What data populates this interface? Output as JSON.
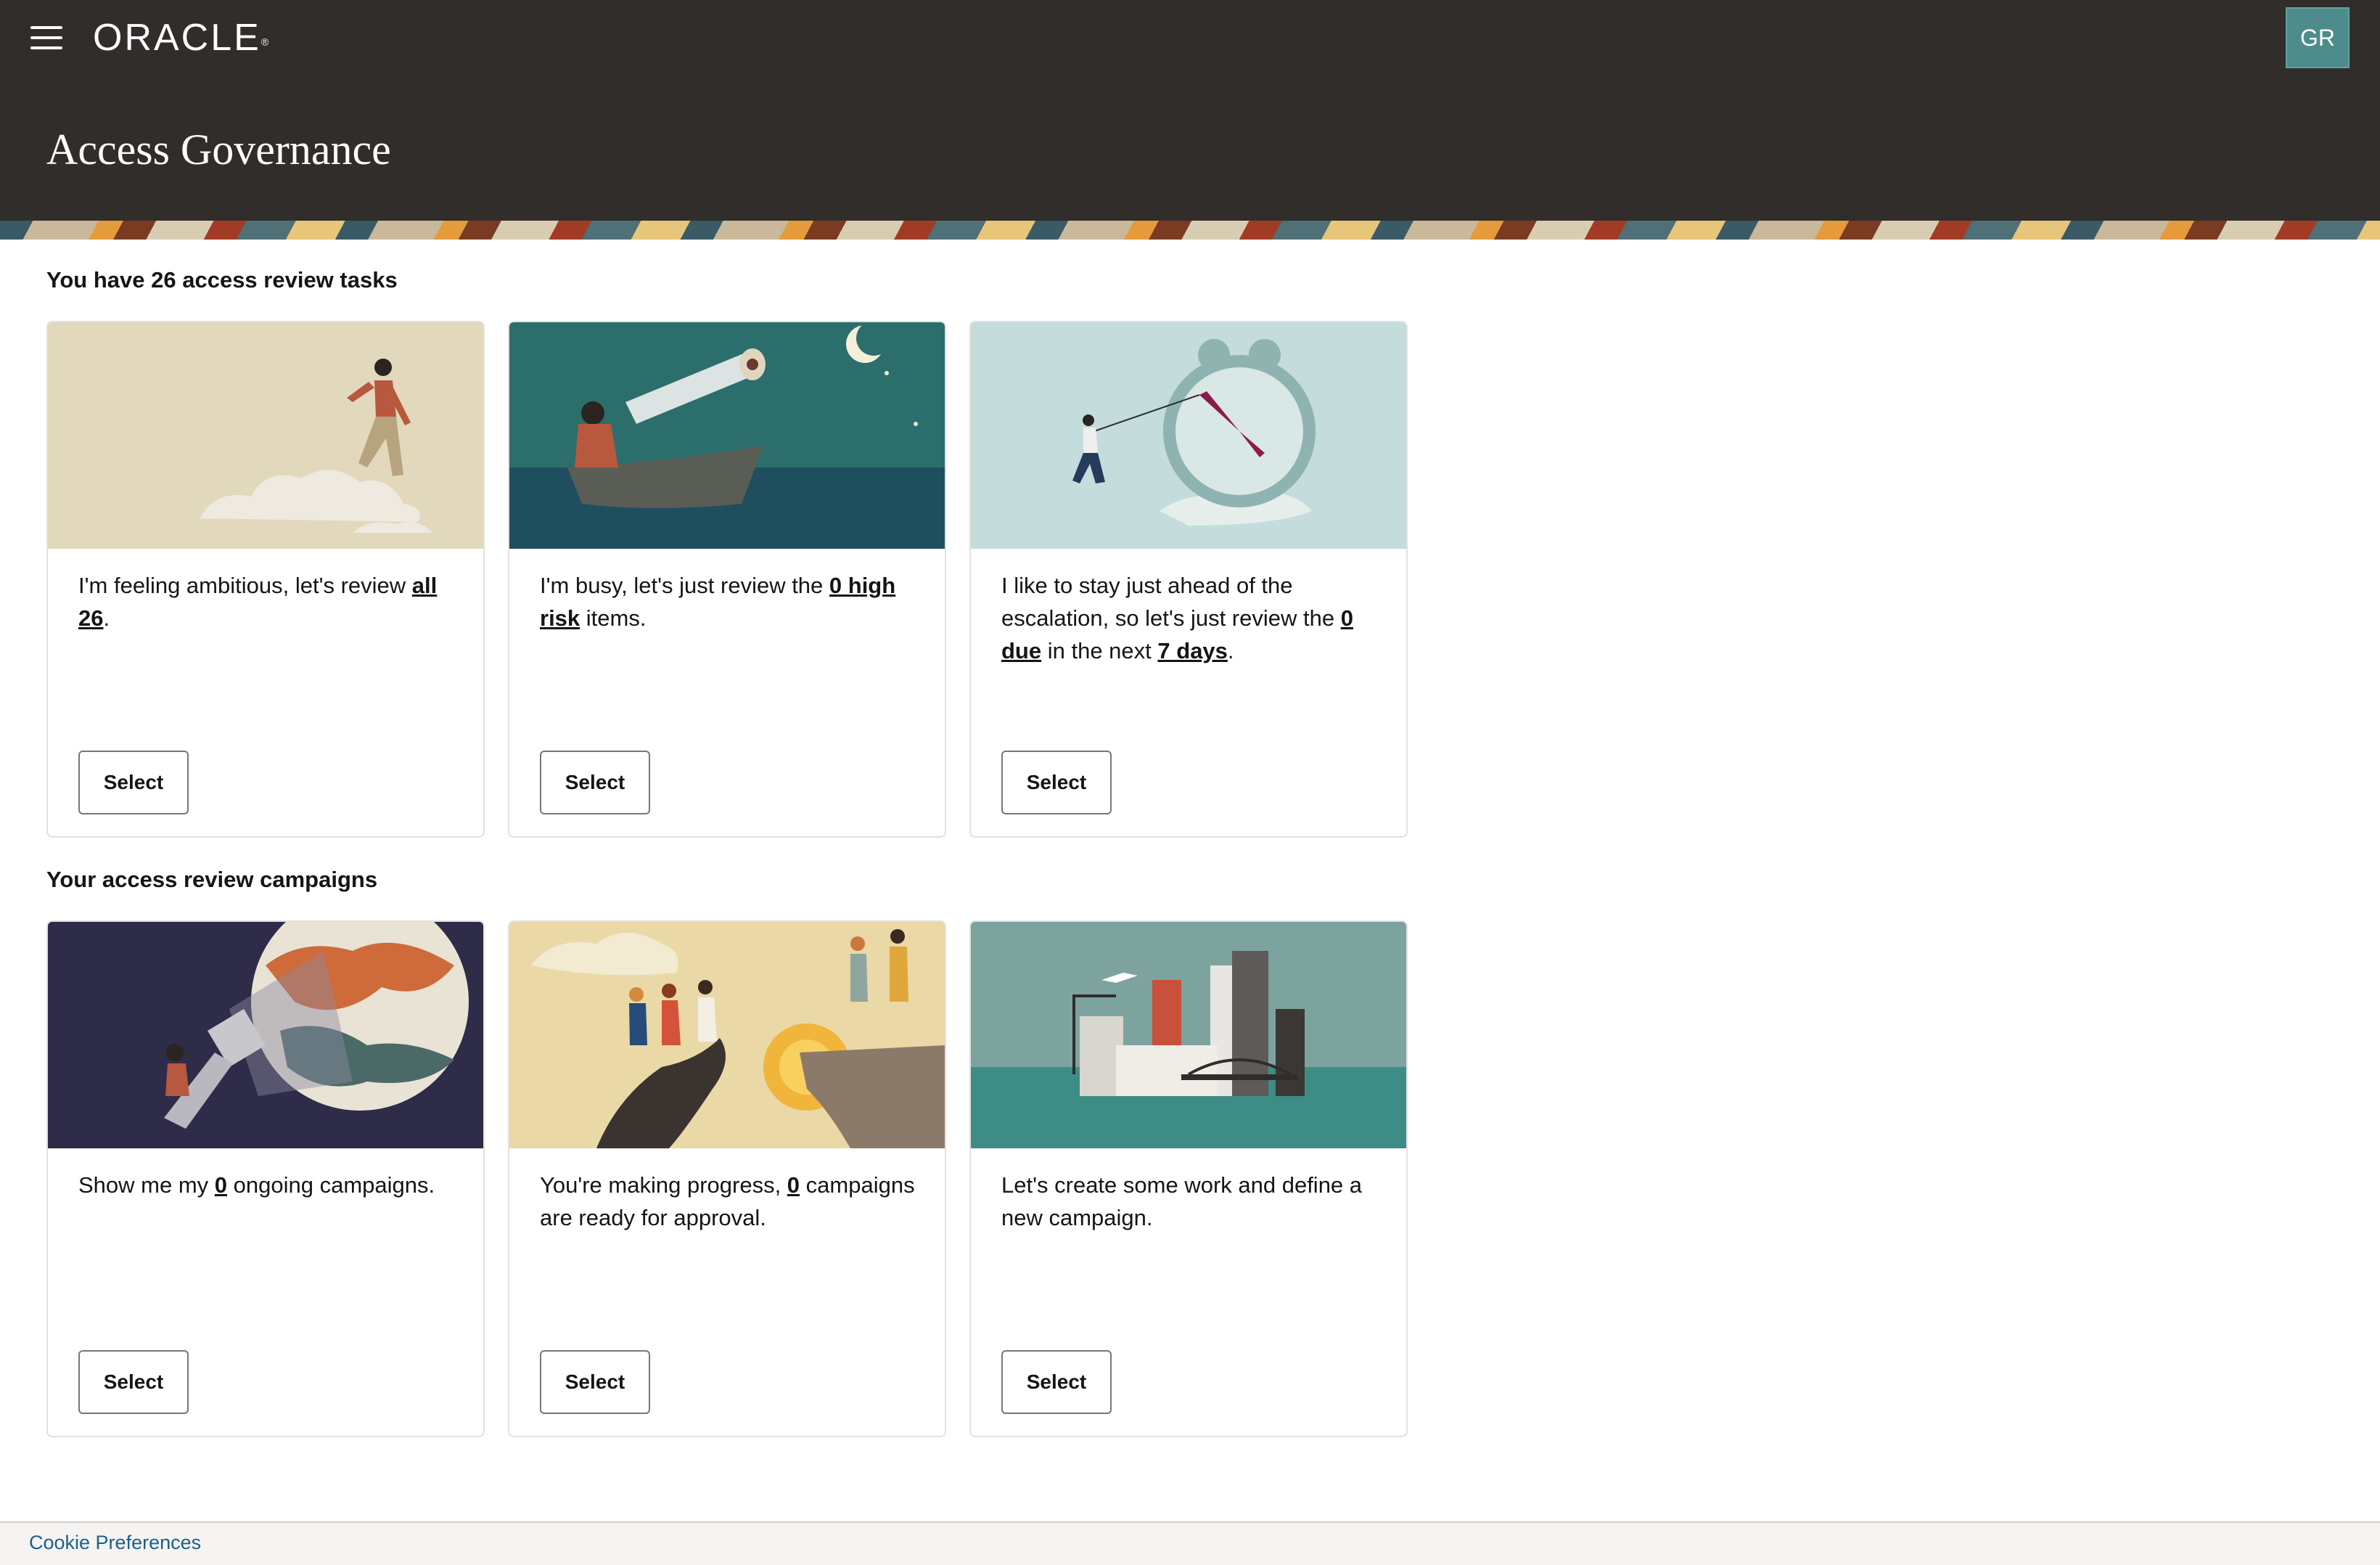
{
  "header": {
    "logo_text": "ORACLE",
    "avatar_initials": "GR",
    "app_title": "Access Governance",
    "bg_color": "#312d2a"
  },
  "tasks_section": {
    "heading": "You have 26 access review tasks",
    "cards": [
      {
        "illustration": "woman-stepping-on-clouds",
        "text_before": "I'm feeling ambitious, let's review ",
        "link1": "all 26",
        "text_after": ".",
        "button": "Select"
      },
      {
        "illustration": "telescope-in-boat",
        "text_before": "I'm busy, let's just review the ",
        "link1": "0 high risk",
        "text_after": " items.",
        "button": "Select"
      },
      {
        "illustration": "man-pulling-clock-hand",
        "text_before": "I like to stay just ahead of the escalation, so let's just review the ",
        "link1": "0 due",
        "text_middle": " in the next ",
        "link2": "7 days",
        "text_after": ".",
        "button": "Select"
      }
    ]
  },
  "campaigns_section": {
    "heading": "Your access review campaigns",
    "cards": [
      {
        "illustration": "flashlight-on-planet",
        "text_before": "Show me my ",
        "link1": "0",
        "text_after": " ongoing campaigns.",
        "button": "Select"
      },
      {
        "illustration": "people-on-cliff",
        "text_before": "You're making progress, ",
        "link1": "0",
        "text_after": " campaigns are ready for approval.",
        "button": "Select"
      },
      {
        "illustration": "city-on-island",
        "text_before": "Let's create some work and define a new campaign.",
        "button": "Select"
      }
    ]
  },
  "footer": {
    "cookie_link": "Cookie Preferences"
  }
}
